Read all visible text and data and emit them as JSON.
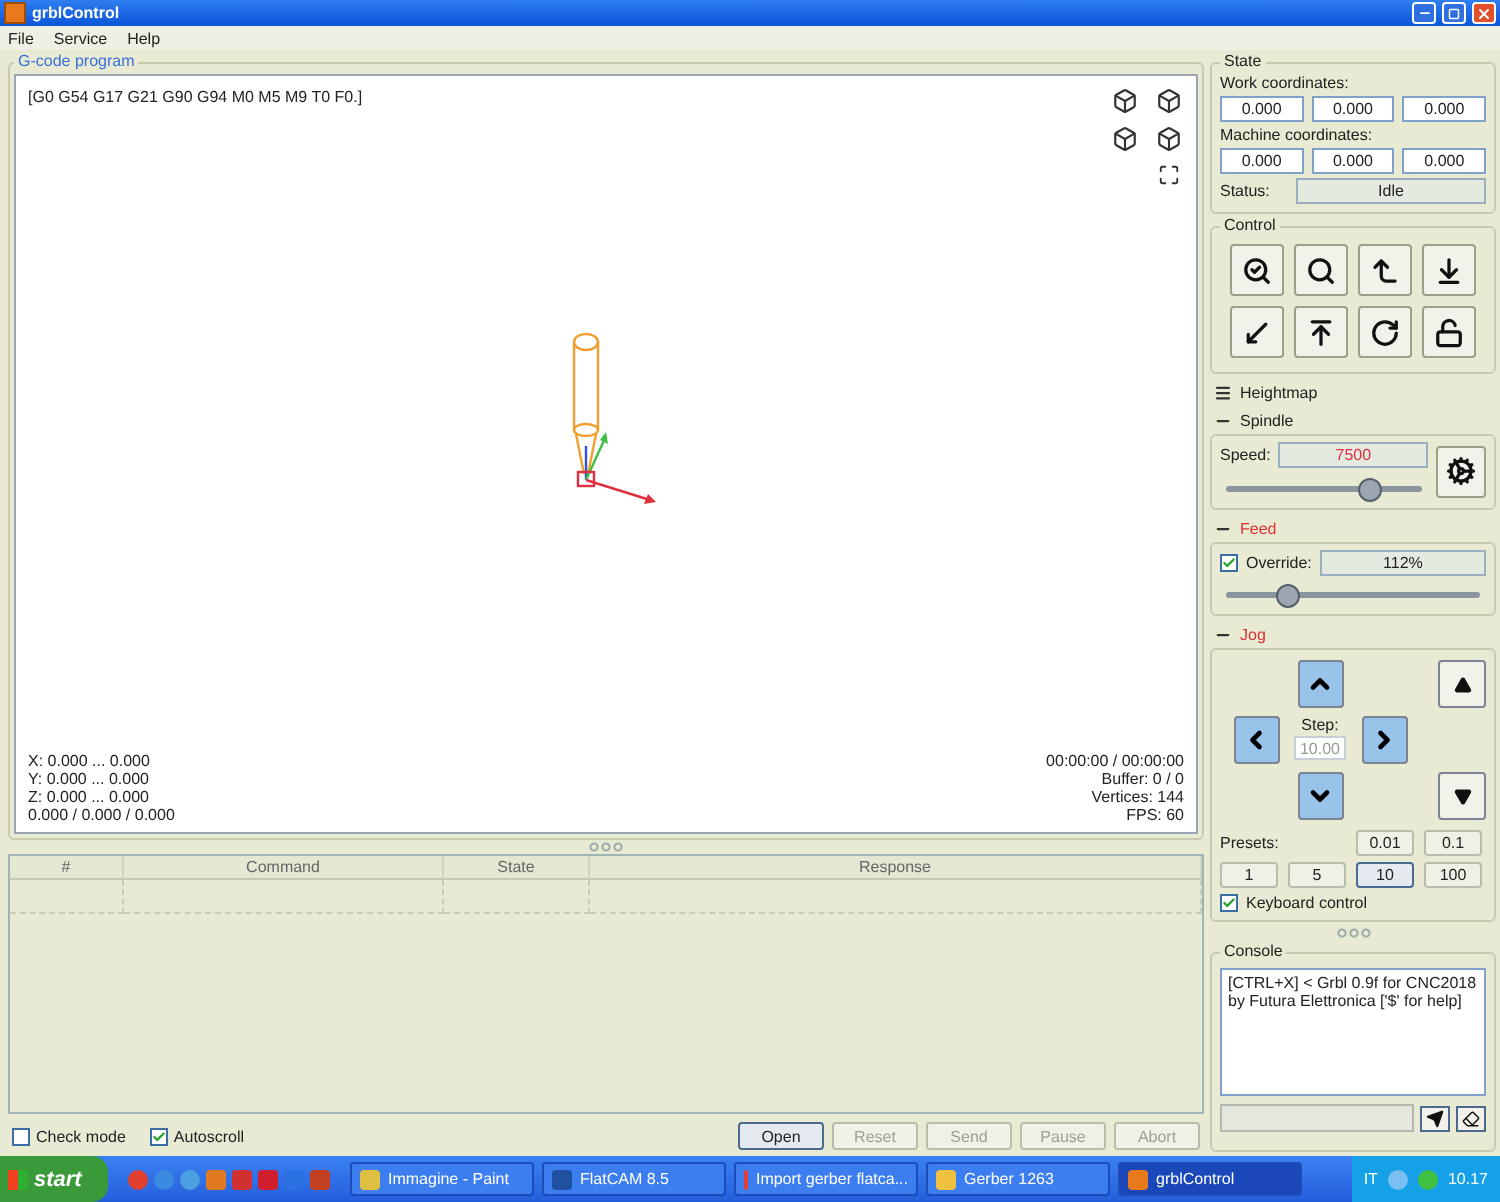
{
  "window": {
    "title": "grblControl"
  },
  "menu": [
    {
      "label": "File"
    },
    {
      "label": "Service"
    },
    {
      "label": "Help"
    }
  ],
  "program": {
    "title": "G-code program",
    "gcode_state": "[G0 G54 G17 G21 G90 G94 M0 M5 M9 T0 F0.]",
    "info_left": [
      "X: 0.000 ... 0.000",
      "Y: 0.000 ... 0.000",
      "Z: 0.000 ... 0.000",
      "0.000 / 0.000 / 0.000"
    ],
    "info_right": [
      "00:00:00 / 00:00:00",
      "Buffer: 0 / 0",
      "Vertices: 144",
      "FPS: 60"
    ]
  },
  "table": {
    "columns": [
      "#",
      "Command",
      "State",
      "Response"
    ]
  },
  "check_mode": {
    "label": "Check mode",
    "checked": false
  },
  "autoscroll": {
    "label": "Autoscroll",
    "checked": true
  },
  "buttons": [
    {
      "label": "Open",
      "disabled": false
    },
    {
      "label": "Reset",
      "disabled": true
    },
    {
      "label": "Send",
      "disabled": true
    },
    {
      "label": "Pause",
      "disabled": true
    },
    {
      "label": "Abort",
      "disabled": true
    }
  ],
  "state": {
    "title": "State",
    "work_label": "Work coordinates:",
    "work": [
      "0.000",
      "0.000",
      "0.000"
    ],
    "machine_label": "Machine coordinates:",
    "machine": [
      "0.000",
      "0.000",
      "0.000"
    ],
    "status_label": "Status:",
    "status": "Idle"
  },
  "control": {
    "title": "Control"
  },
  "heightmap": {
    "title": "Heightmap",
    "expanded": false,
    "highlighted": false
  },
  "spindle": {
    "title": "Spindle",
    "expanded": true,
    "highlighted": false,
    "speed_label": "Speed:",
    "speed": "7500",
    "level": 0.72
  },
  "feed": {
    "title": "Feed",
    "expanded": true,
    "highlighted": true,
    "override_label": "Override:",
    "override_checked": true,
    "override": "112%",
    "level": 0.24
  },
  "jog": {
    "title": "Jog",
    "expanded": true,
    "highlighted": true,
    "step_label": "Step:",
    "step": "10.00",
    "presets_label": "Presets:",
    "presets": [
      {
        "label": "0.01",
        "selected": false
      },
      {
        "label": "0.1",
        "selected": false
      },
      {
        "label": "1",
        "selected": false
      },
      {
        "label": "5",
        "selected": false
      },
      {
        "label": "10",
        "selected": true
      },
      {
        "label": "100",
        "selected": false
      }
    ],
    "keyboard": {
      "label": "Keyboard control",
      "checked": true
    }
  },
  "console": {
    "title": "Console",
    "lines": [
      "[CTRL+X] < Grbl 0.9f for CNC2018",
      "by Futura Elettronica ['$' for help]"
    ]
  },
  "taskbar": {
    "start": "start",
    "tasks": [
      {
        "label": "Immagine - Paint",
        "selected": false
      },
      {
        "label": "FlatCAM 8.5",
        "selected": false
      },
      {
        "label": "Import gerber flatca...",
        "selected": false
      },
      {
        "label": "Gerber 1263",
        "selected": false
      },
      {
        "label": "grblControl",
        "selected": true
      }
    ],
    "language": "IT",
    "clock": "10.17"
  }
}
